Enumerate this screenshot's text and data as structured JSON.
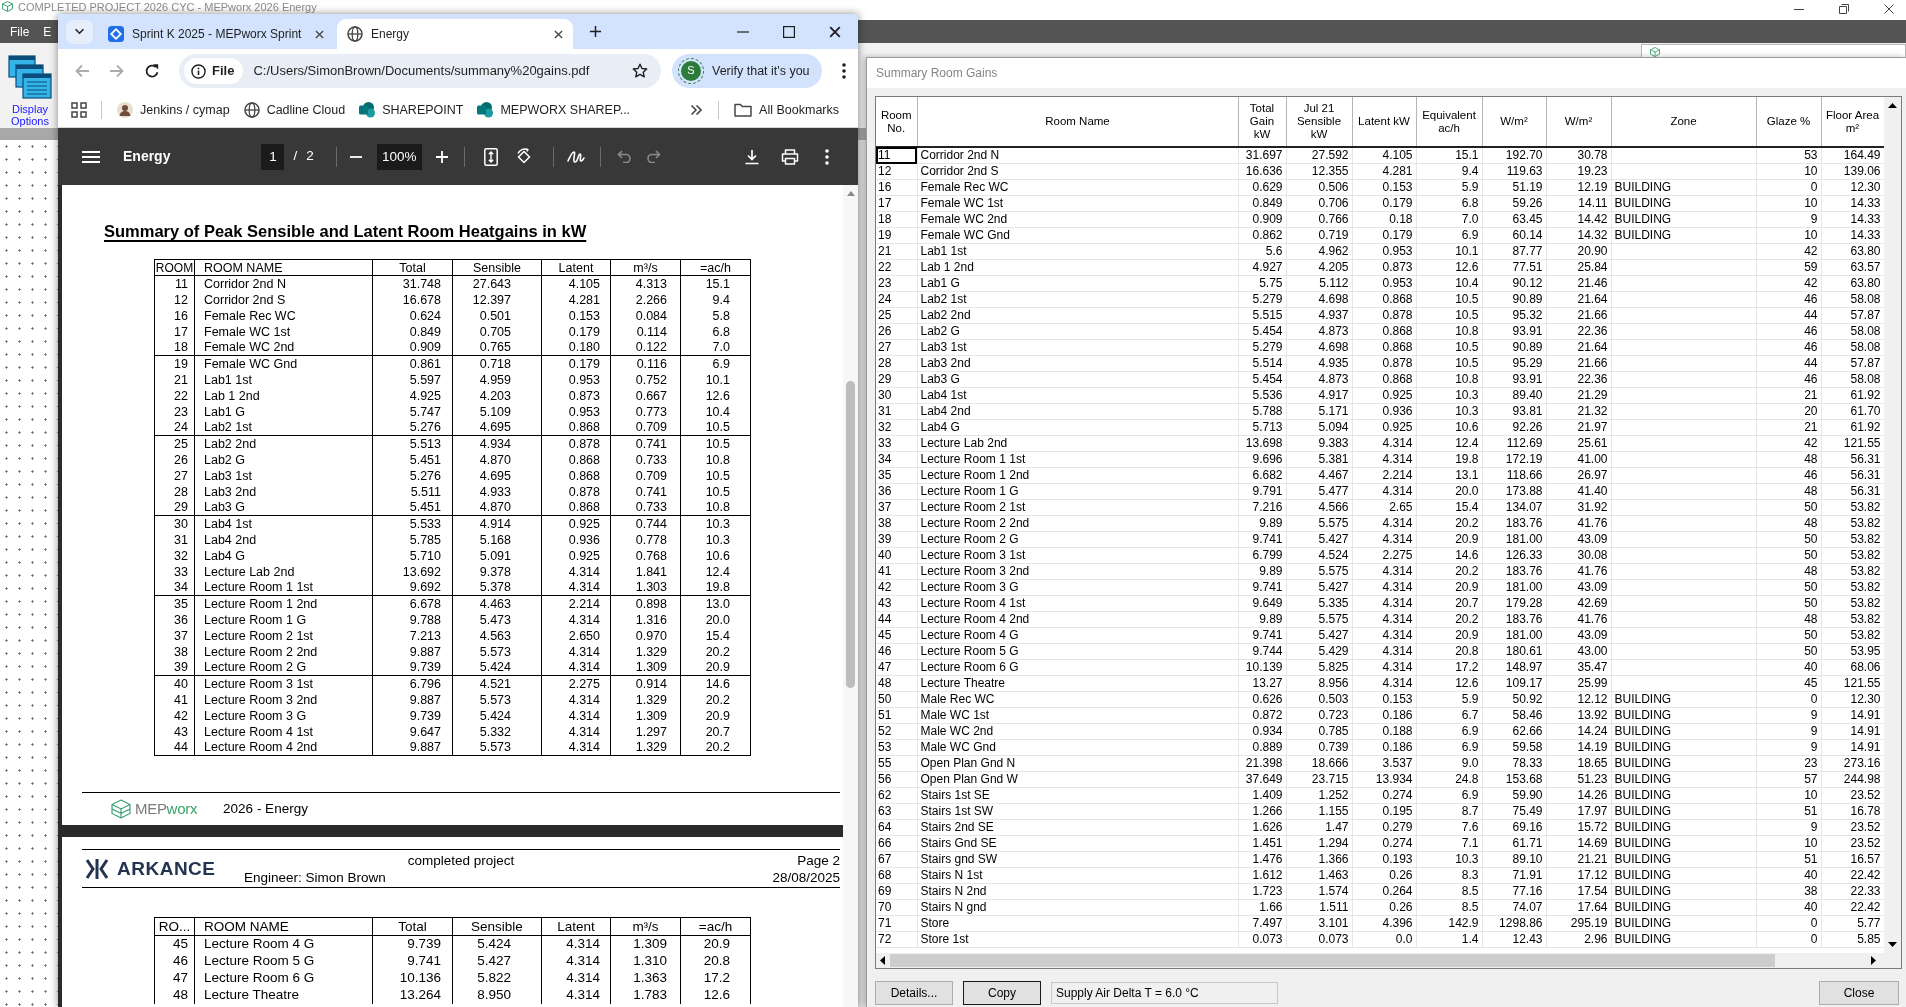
{
  "app": {
    "title": "COMPLETED PROJECT 2026 CYC - MEPworx 2026 Energy",
    "menu": [
      "File",
      "E"
    ],
    "toolbar": [
      {
        "label": "Display Options"
      }
    ]
  },
  "browser": {
    "tabs": [
      {
        "title": "Sprint K 2025 - MEPworx Sprint",
        "kind": "board",
        "selected": false
      },
      {
        "title": "Energy",
        "kind": "globe",
        "selected": true
      }
    ],
    "nav": [
      {
        "kind": "back",
        "disabled": true
      },
      {
        "kind": "forward",
        "disabled": true
      },
      {
        "kind": "reload",
        "disabled": false
      }
    ],
    "address": {
      "chip": "File",
      "url": "C:/Users/SimonBrown/Documents/summany%20gains.pdf"
    },
    "profile": {
      "initial": "S",
      "label": "Verify that it's you"
    },
    "bookmarks": [
      {
        "label": "Jenkins / cymap",
        "kind": "person"
      },
      {
        "label": "Cadline Cloud",
        "kind": "globe"
      },
      {
        "label": "SHAREPOINT",
        "kind": "tiles"
      },
      {
        "label": "MEPWORX SHAREP...",
        "kind": "tiles"
      }
    ],
    "bookmarks_folder": "All Bookmarks"
  },
  "pdf_viewer": {
    "title": "Energy",
    "page": "1",
    "page_separator": "/",
    "page_count": "2",
    "zoom": "100%",
    "history": [
      {
        "kind": "undo",
        "disabled": true
      },
      {
        "kind": "redo",
        "disabled": true
      }
    ],
    "pages": [
      {
        "heading": "Summary of Peak Sensible and Latent Room Heatgains in kW",
        "table": {
          "columns": [
            "ROOM",
            "ROOM NAME",
            "Total",
            "Sensible",
            "Latent",
            "m³/s",
            "=ac/h"
          ],
          "rows": [
            [
              "11",
              "Corridor 2nd N",
              "31.748",
              "27.643",
              "4.105",
              "4.313",
              "15.1"
            ],
            [
              "12",
              "Corridor 2nd S",
              "16.678",
              "12.397",
              "4.281",
              "2.266",
              "9.4"
            ],
            [
              "16",
              "Female Rec WC",
              "0.624",
              "0.501",
              "0.153",
              "0.084",
              "5.8"
            ],
            [
              "17",
              "Female WC 1st",
              "0.849",
              "0.705",
              "0.179",
              "0.114",
              "6.8"
            ],
            [
              "18",
              "Female WC 2nd",
              "0.909",
              "0.765",
              "0.180",
              "0.122",
              "7.0"
            ],
            [
              "19",
              "Female WC Gnd",
              "0.861",
              "0.718",
              "0.179",
              "0.116",
              "6.9"
            ],
            [
              "21",
              "Lab1 1st",
              "5.597",
              "4.959",
              "0.953",
              "0.752",
              "10.1"
            ],
            [
              "22",
              "Lab 1 2nd",
              "4.925",
              "4.203",
              "0.873",
              "0.667",
              "12.6"
            ],
            [
              "23",
              "Lab1 G",
              "5.747",
              "5.109",
              "0.953",
              "0.773",
              "10.4"
            ],
            [
              "24",
              "Lab2 1st",
              "5.276",
              "4.695",
              "0.868",
              "0.709",
              "10.5"
            ],
            [
              "25",
              "Lab2 2nd",
              "5.513",
              "4.934",
              "0.878",
              "0.741",
              "10.5"
            ],
            [
              "26",
              "Lab2 G",
              "5.451",
              "4.870",
              "0.868",
              "0.733",
              "10.8"
            ],
            [
              "27",
              "Lab3 1st",
              "5.276",
              "4.695",
              "0.868",
              "0.709",
              "10.5"
            ],
            [
              "28",
              "Lab3 2nd",
              "5.511",
              "4.933",
              "0.878",
              "0.741",
              "10.5"
            ],
            [
              "29",
              "Lab3 G",
              "5.451",
              "4.870",
              "0.868",
              "0.733",
              "10.8"
            ],
            [
              "30",
              "Lab4 1st",
              "5.533",
              "4.914",
              "0.925",
              "0.744",
              "10.3"
            ],
            [
              "31",
              "Lab4 2nd",
              "5.785",
              "5.168",
              "0.936",
              "0.778",
              "10.3"
            ],
            [
              "32",
              "Lab4 G",
              "5.710",
              "5.091",
              "0.925",
              "0.768",
              "10.6"
            ],
            [
              "33",
              "Lecture Lab 2nd",
              "13.692",
              "9.378",
              "4.314",
              "1.841",
              "12.4"
            ],
            [
              "34",
              "Lecture Room 1 1st",
              "9.692",
              "5.378",
              "4.314",
              "1.303",
              "19.8"
            ],
            [
              "35",
              "Lecture Room 1 2nd",
              "6.678",
              "4.463",
              "2.214",
              "0.898",
              "13.0"
            ],
            [
              "36",
              "Lecture Room 1 G",
              "9.788",
              "5.473",
              "4.314",
              "1.316",
              "20.0"
            ],
            [
              "37",
              "Lecture Room 2 1st",
              "7.213",
              "4.563",
              "2.650",
              "0.970",
              "15.4"
            ],
            [
              "38",
              "Lecture Room 2 2nd",
              "9.887",
              "5.573",
              "4.314",
              "1.329",
              "20.2"
            ],
            [
              "39",
              "Lecture Room 2 G",
              "9.739",
              "5.424",
              "4.314",
              "1.309",
              "20.9"
            ],
            [
              "40",
              "Lecture Room 3 1st",
              "6.796",
              "4.521",
              "2.275",
              "0.914",
              "14.6"
            ],
            [
              "41",
              "Lecture Room 3 2nd",
              "9.887",
              "5.573",
              "4.314",
              "1.329",
              "20.2"
            ],
            [
              "42",
              "Lecture Room 3 G",
              "9.739",
              "5.424",
              "4.314",
              "1.309",
              "20.9"
            ],
            [
              "43",
              "Lecture Room 4 1st",
              "9.647",
              "5.332",
              "4.314",
              "1.297",
              "20.7"
            ],
            [
              "44",
              "Lecture Room 4 2nd",
              "9.887",
              "5.573",
              "4.314",
              "1.329",
              "20.2"
            ]
          ]
        },
        "footer": {
          "logo": [
            "MEP",
            "worx"
          ],
          "text": "2026 - Energy"
        }
      },
      {
        "header": {
          "logo": "ARKANCE",
          "project": "completed project",
          "engineer": "Engineer: Simon Brown",
          "page": "Page 2",
          "date": "28/08/2025"
        },
        "table": {
          "columns": [
            "RO...",
            "ROOM NAME",
            "Total",
            "Sensible",
            "Latent",
            "m³/s",
            "=ac/h"
          ],
          "rows": [
            [
              "45",
              "Lecture Room 4 G",
              "9.739",
              "5.424",
              "4.314",
              "1.309",
              "20.9"
            ],
            [
              "46",
              "Lecture Room 5 G",
              "9.741",
              "5.427",
              "4.314",
              "1.310",
              "20.8"
            ],
            [
              "47",
              "Lecture Room 6 G",
              "10.136",
              "5.822",
              "4.314",
              "1.363",
              "17.2"
            ],
            [
              "48",
              "Lecture Theatre",
              "13.264",
              "8.950",
              "4.314",
              "1.783",
              "12.6"
            ]
          ]
        }
      }
    ]
  },
  "dialog": {
    "title": "Summary Room Gains",
    "table": {
      "columns": [
        "Room No.",
        "Room Name",
        "Total Gain kW",
        "Jul 21 Sensible kW",
        "Latent kW",
        "Equivalent ac/h",
        "W/m²",
        "W/m²",
        "Zone",
        "Glaze %",
        "Floor Area m²"
      ],
      "rows": [
        {
          "cells": [
            "11",
            "Corridor 2nd N",
            "31.697",
            "27.592",
            "4.105",
            "15.1",
            "192.70",
            "30.78",
            null,
            "53",
            "164.49"
          ],
          "selected": true
        },
        {
          "cells": [
            "12",
            "Corridor 2nd S",
            "16.636",
            "12.355",
            "4.281",
            "9.4",
            "119.63",
            "19.23",
            null,
            "10",
            "139.06"
          ],
          "selected": false
        },
        {
          "cells": [
            "16",
            "Female Rec WC",
            "0.629",
            "0.506",
            "0.153",
            "5.9",
            "51.19",
            "12.19",
            "BUILDING",
            "0",
            "12.30"
          ],
          "selected": false
        },
        {
          "cells": [
            "17",
            "Female WC 1st",
            "0.849",
            "0.706",
            "0.179",
            "6.8",
            "59.26",
            "14.11",
            "BUILDING",
            "10",
            "14.33"
          ],
          "selected": false
        },
        {
          "cells": [
            "18",
            "Female WC 2nd",
            "0.909",
            "0.766",
            "0.18",
            "7.0",
            "63.45",
            "14.42",
            "BUILDING",
            "9",
            "14.33"
          ],
          "selected": false
        },
        {
          "cells": [
            "19",
            "Female WC Gnd",
            "0.862",
            "0.719",
            "0.179",
            "6.9",
            "60.14",
            "14.32",
            "BUILDING",
            "10",
            "14.33"
          ],
          "selected": false
        },
        {
          "cells": [
            "21",
            "Lab1 1st",
            "5.6",
            "4.962",
            "0.953",
            "10.1",
            "87.77",
            "20.90",
            null,
            "42",
            "63.80"
          ],
          "selected": false
        },
        {
          "cells": [
            "22",
            "Lab 1 2nd",
            "4.927",
            "4.205",
            "0.873",
            "12.6",
            "77.51",
            "25.84",
            null,
            "59",
            "63.57"
          ],
          "selected": false
        },
        {
          "cells": [
            "23",
            "Lab1 G",
            "5.75",
            "5.112",
            "0.953",
            "10.4",
            "90.12",
            "21.46",
            null,
            "42",
            "63.80"
          ],
          "selected": false
        },
        {
          "cells": [
            "24",
            "Lab2 1st",
            "5.279",
            "4.698",
            "0.868",
            "10.5",
            "90.89",
            "21.64",
            null,
            "46",
            "58.08"
          ],
          "selected": false
        },
        {
          "cells": [
            "25",
            "Lab2 2nd",
            "5.515",
            "4.937",
            "0.878",
            "10.5",
            "95.32",
            "21.66",
            null,
            "44",
            "57.87"
          ],
          "selected": false
        },
        {
          "cells": [
            "26",
            "Lab2 G",
            "5.454",
            "4.873",
            "0.868",
            "10.8",
            "93.91",
            "22.36",
            null,
            "46",
            "58.08"
          ],
          "selected": false
        },
        {
          "cells": [
            "27",
            "Lab3 1st",
            "5.279",
            "4.698",
            "0.868",
            "10.5",
            "90.89",
            "21.64",
            null,
            "46",
            "58.08"
          ],
          "selected": false
        },
        {
          "cells": [
            "28",
            "Lab3 2nd",
            "5.514",
            "4.935",
            "0.878",
            "10.5",
            "95.29",
            "21.66",
            null,
            "44",
            "57.87"
          ],
          "selected": false
        },
        {
          "cells": [
            "29",
            "Lab3 G",
            "5.454",
            "4.873",
            "0.868",
            "10.8",
            "93.91",
            "22.36",
            null,
            "46",
            "58.08"
          ],
          "selected": false
        },
        {
          "cells": [
            "30",
            "Lab4 1st",
            "5.536",
            "4.917",
            "0.925",
            "10.3",
            "89.40",
            "21.29",
            null,
            "21",
            "61.92"
          ],
          "selected": false
        },
        {
          "cells": [
            "31",
            "Lab4 2nd",
            "5.788",
            "5.171",
            "0.936",
            "10.3",
            "93.81",
            "21.32",
            null,
            "20",
            "61.70"
          ],
          "selected": false
        },
        {
          "cells": [
            "32",
            "Lab4 G",
            "5.713",
            "5.094",
            "0.925",
            "10.6",
            "92.26",
            "21.97",
            null,
            "21",
            "61.92"
          ],
          "selected": false
        },
        {
          "cells": [
            "33",
            "Lecture Lab 2nd",
            "13.698",
            "9.383",
            "4.314",
            "12.4",
            "112.69",
            "25.61",
            null,
            "42",
            "121.55"
          ],
          "selected": false
        },
        {
          "cells": [
            "34",
            "Lecture Room 1 1st",
            "9.696",
            "5.381",
            "4.314",
            "19.8",
            "172.19",
            "41.00",
            null,
            "48",
            "56.31"
          ],
          "selected": false
        },
        {
          "cells": [
            "35",
            "Lecture Room 1 2nd",
            "6.682",
            "4.467",
            "2.214",
            "13.1",
            "118.66",
            "26.97",
            null,
            "46",
            "56.31"
          ],
          "selected": false
        },
        {
          "cells": [
            "36",
            "Lecture Room 1 G",
            "9.791",
            "5.477",
            "4.314",
            "20.0",
            "173.88",
            "41.40",
            null,
            "48",
            "56.31"
          ],
          "selected": false
        },
        {
          "cells": [
            "37",
            "Lecture Room 2 1st",
            "7.216",
            "4.566",
            "2.65",
            "15.4",
            "134.07",
            "31.92",
            null,
            "50",
            "53.82"
          ],
          "selected": false
        },
        {
          "cells": [
            "38",
            "Lecture Room 2 2nd",
            "9.89",
            "5.575",
            "4.314",
            "20.2",
            "183.76",
            "41.76",
            null,
            "48",
            "53.82"
          ],
          "selected": false
        },
        {
          "cells": [
            "39",
            "Lecture Room 2 G",
            "9.741",
            "5.427",
            "4.314",
            "20.9",
            "181.00",
            "43.09",
            null,
            "50",
            "53.82"
          ],
          "selected": false
        },
        {
          "cells": [
            "40",
            "Lecture Room 3 1st",
            "6.799",
            "4.524",
            "2.275",
            "14.6",
            "126.33",
            "30.08",
            null,
            "50",
            "53.82"
          ],
          "selected": false
        },
        {
          "cells": [
            "41",
            "Lecture Room 3 2nd",
            "9.89",
            "5.575",
            "4.314",
            "20.2",
            "183.76",
            "41.76",
            null,
            "48",
            "53.82"
          ],
          "selected": false
        },
        {
          "cells": [
            "42",
            "Lecture Room 3 G",
            "9.741",
            "5.427",
            "4.314",
            "20.9",
            "181.00",
            "43.09",
            null,
            "50",
            "53.82"
          ],
          "selected": false
        },
        {
          "cells": [
            "43",
            "Lecture Room 4 1st",
            "9.649",
            "5.335",
            "4.314",
            "20.7",
            "179.28",
            "42.69",
            null,
            "50",
            "53.82"
          ],
          "selected": false
        },
        {
          "cells": [
            "44",
            "Lecture Room 4 2nd",
            "9.89",
            "5.575",
            "4.314",
            "20.2",
            "183.76",
            "41.76",
            null,
            "48",
            "53.82"
          ],
          "selected": false
        },
        {
          "cells": [
            "45",
            "Lecture Room 4 G",
            "9.741",
            "5.427",
            "4.314",
            "20.9",
            "181.00",
            "43.09",
            null,
            "50",
            "53.82"
          ],
          "selected": false
        },
        {
          "cells": [
            "46",
            "Lecture Room 5 G",
            "9.744",
            "5.429",
            "4.314",
            "20.8",
            "180.61",
            "43.00",
            null,
            "50",
            "53.95"
          ],
          "selected": false
        },
        {
          "cells": [
            "47",
            "Lecture Room 6 G",
            "10.139",
            "5.825",
            "4.314",
            "17.2",
            "148.97",
            "35.47",
            null,
            "40",
            "68.06"
          ],
          "selected": false
        },
        {
          "cells": [
            "48",
            "Lecture Theatre",
            "13.27",
            "8.956",
            "4.314",
            "12.6",
            "109.17",
            "25.99",
            null,
            "45",
            "121.55"
          ],
          "selected": false
        },
        {
          "cells": [
            "50",
            "Male Rec WC",
            "0.626",
            "0.503",
            "0.153",
            "5.9",
            "50.92",
            "12.12",
            "BUILDING",
            "0",
            "12.30"
          ],
          "selected": false
        },
        {
          "cells": [
            "51",
            "Male WC 1st",
            "0.872",
            "0.723",
            "0.186",
            "6.7",
            "58.46",
            "13.92",
            "BUILDING",
            "9",
            "14.91"
          ],
          "selected": false
        },
        {
          "cells": [
            "52",
            "Male WC 2nd",
            "0.934",
            "0.785",
            "0.188",
            "6.9",
            "62.66",
            "14.24",
            "BUILDING",
            "9",
            "14.91"
          ],
          "selected": false
        },
        {
          "cells": [
            "53",
            "Male WC Gnd",
            "0.889",
            "0.739",
            "0.186",
            "6.9",
            "59.58",
            "14.19",
            "BUILDING",
            "9",
            "14.91"
          ],
          "selected": false
        },
        {
          "cells": [
            "55",
            "Open Plan Gnd N",
            "21.398",
            "18.666",
            "3.537",
            "9.0",
            "78.33",
            "18.65",
            "BUILDING",
            "23",
            "273.16"
          ],
          "selected": false
        },
        {
          "cells": [
            "56",
            "Open Plan Gnd W",
            "37.649",
            "23.715",
            "13.934",
            "24.8",
            "153.68",
            "51.23",
            "BUILDING",
            "57",
            "244.98"
          ],
          "selected": false
        },
        {
          "cells": [
            "62",
            "Stairs 1st SE",
            "1.409",
            "1.252",
            "0.274",
            "6.9",
            "59.90",
            "14.26",
            "BUILDING",
            "10",
            "23.52"
          ],
          "selected": false
        },
        {
          "cells": [
            "63",
            "Stairs 1st SW",
            "1.266",
            "1.155",
            "0.195",
            "8.7",
            "75.49",
            "17.97",
            "BUILDING",
            "51",
            "16.78"
          ],
          "selected": false
        },
        {
          "cells": [
            "64",
            "Stairs 2nd SE",
            "1.626",
            "1.47",
            "0.279",
            "7.6",
            "69.16",
            "15.72",
            "BUILDING",
            "9",
            "23.52"
          ],
          "selected": false
        },
        {
          "cells": [
            "66",
            "Stairs Gnd SE",
            "1.451",
            "1.294",
            "0.274",
            "7.1",
            "61.71",
            "14.69",
            "BUILDING",
            "10",
            "23.52"
          ],
          "selected": false
        },
        {
          "cells": [
            "67",
            "Stairs gnd SW",
            "1.476",
            "1.366",
            "0.193",
            "10.3",
            "89.10",
            "21.21",
            "BUILDING",
            "51",
            "16.57"
          ],
          "selected": false
        },
        {
          "cells": [
            "68",
            "Stairs N 1st",
            "1.612",
            "1.463",
            "0.26",
            "8.3",
            "71.91",
            "17.12",
            "BUILDING",
            "40",
            "22.42"
          ],
          "selected": false
        },
        {
          "cells": [
            "69",
            "Stairs N 2nd",
            "1.723",
            "1.574",
            "0.264",
            "8.5",
            "77.16",
            "17.54",
            "BUILDING",
            "38",
            "22.33"
          ],
          "selected": false
        },
        {
          "cells": [
            "70",
            "Stairs N gnd",
            "1.66",
            "1.511",
            "0.26",
            "8.5",
            "74.07",
            "17.64",
            "BUILDING",
            "40",
            "22.42"
          ],
          "selected": false
        },
        {
          "cells": [
            "71",
            "Store",
            "7.497",
            "3.101",
            "4.396",
            "142.9",
            "1298.86",
            "295.19",
            "BUILDING",
            "0",
            "5.77"
          ],
          "selected": false
        },
        {
          "cells": [
            "72",
            "Store 1st",
            "0.073",
            "0.073",
            "0.0",
            "1.4",
            "12.43",
            "2.96",
            "BUILDING",
            "0",
            "5.85"
          ],
          "selected": false
        }
      ]
    },
    "buttons": [
      {
        "label": "Details...",
        "kind": "normal"
      },
      {
        "label": "Copy",
        "kind": "default"
      }
    ],
    "status": "Supply Air Delta T = 6.0 °C",
    "close": "Close"
  }
}
